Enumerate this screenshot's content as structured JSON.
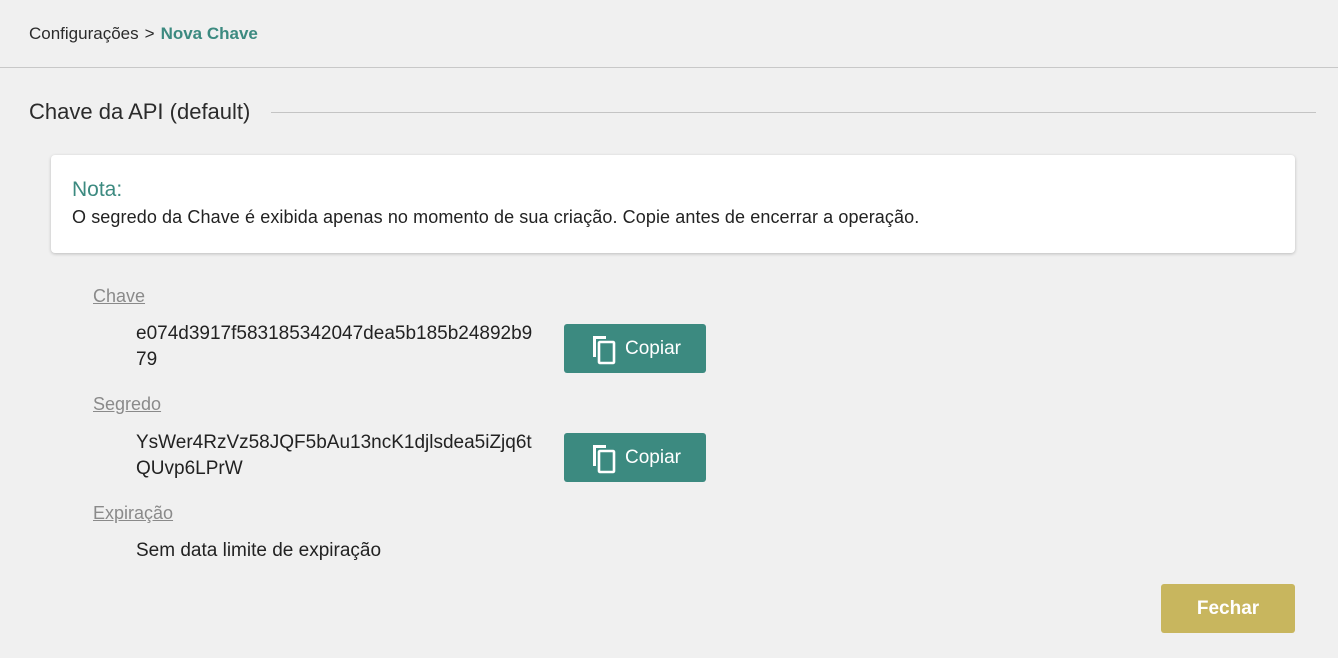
{
  "breadcrumb": {
    "parent": "Configurações",
    "separator": ">",
    "current": "Nova Chave"
  },
  "section": {
    "title": "Chave da API (default)"
  },
  "note": {
    "title": "Nota:",
    "text": "O segredo da Chave é exibida apenas no momento de sua criação. Copie antes de encerrar a operação."
  },
  "fields": {
    "key": {
      "label": "Chave",
      "value": "e074d3917f583185342047dea5b185b24892b979",
      "copy_label": "Copiar"
    },
    "secret": {
      "label": "Segredo",
      "value": "YsWer4RzVz58JQF5bAu13ncK1djlsdea5iZjq6tQUvp6LPrW",
      "copy_label": "Copiar"
    },
    "expiration": {
      "label": "Expiração",
      "value": "Sem data limite de expiração"
    }
  },
  "actions": {
    "close_label": "Fechar"
  },
  "colors": {
    "accent": "#3c8a80",
    "close_button": "#c8b65e",
    "background": "#f0f0f0"
  },
  "icons": {
    "copy": "copy-icon"
  }
}
